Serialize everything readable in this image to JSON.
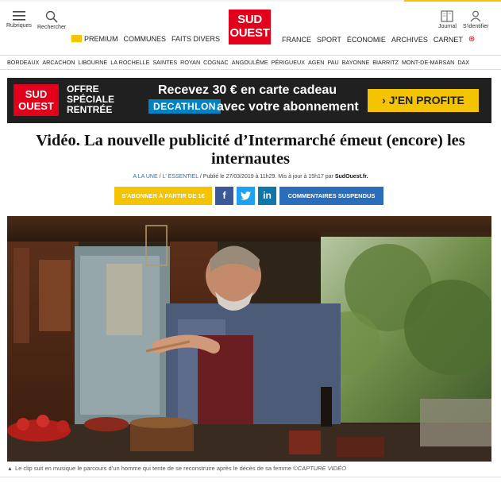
{
  "header": {
    "menu_label": "Rubriques",
    "search_label": "Rechercher",
    "journal_label": "Journal",
    "login_label": "S'identifier",
    "logo_line1": "SUD",
    "logo_line2": "OUEST"
  },
  "nav_main_left": [
    "PREMIUM",
    "COMMUNES",
    "FAITS DIVERS"
  ],
  "nav_main_right": [
    "FRANCE",
    "SPORT",
    "ÉCONOMIE",
    "ARCHIVES",
    "CARNET"
  ],
  "nav_cities": [
    "BORDEAUX",
    "ARCACHON",
    "LIBOURNE",
    "LA ROCHELLE",
    "SAINTES",
    "ROYAN",
    "COGNAC",
    "ANGOULÊME",
    "PÉRIGUEUX",
    "AGEN",
    "PAU",
    "BAYONNE",
    "BIARRITZ",
    "MONT-DE-MARSAN",
    "DAX"
  ],
  "banner": {
    "logo_line1": "SUD",
    "logo_line2": "OUEST",
    "offer_line1": "OFFRE",
    "offer_line2": "SPÉCIALE",
    "offer_line3": "RENTRÉE",
    "main_text": "Recevez 30 € en carte cadeau",
    "brand": "DECATHLON",
    "sub_text": "avec votre abonnement",
    "cta": "› J'EN PROFITE"
  },
  "article": {
    "headline": "Vidéo. La nouvelle publicité d’Intermarché émeut (encore) les internautes",
    "crumb1": "A LA UNE",
    "sep1": "/",
    "crumb2": "L' ESSENTIEL",
    "sep2": "/",
    "published": "Publié le 27/03/2019 à 11h29. Mis à jour à 15h17 par",
    "author": "SudOuest.fr.",
    "subscribe_button": "S'ABONNER À PARTIR DE 1€",
    "facebook": "f",
    "linkedin": "in",
    "comments_button": "COMMENTAIRES SUSPENDUS",
    "caption_marker": "▲",
    "caption": "Le clip suit en musique le parcours d’un homme qui tente de se reconstruire après le décès de sa femme ©",
    "caption_credit": "CAPTURE VIDÉO"
  },
  "colors": {
    "brand_red": "#e2001a",
    "accent_yellow": "#f5c400",
    "link_blue": "#2a6ebb",
    "facebook": "#3b5998",
    "twitter": "#1da1f2",
    "linkedin": "#0e76a8"
  }
}
